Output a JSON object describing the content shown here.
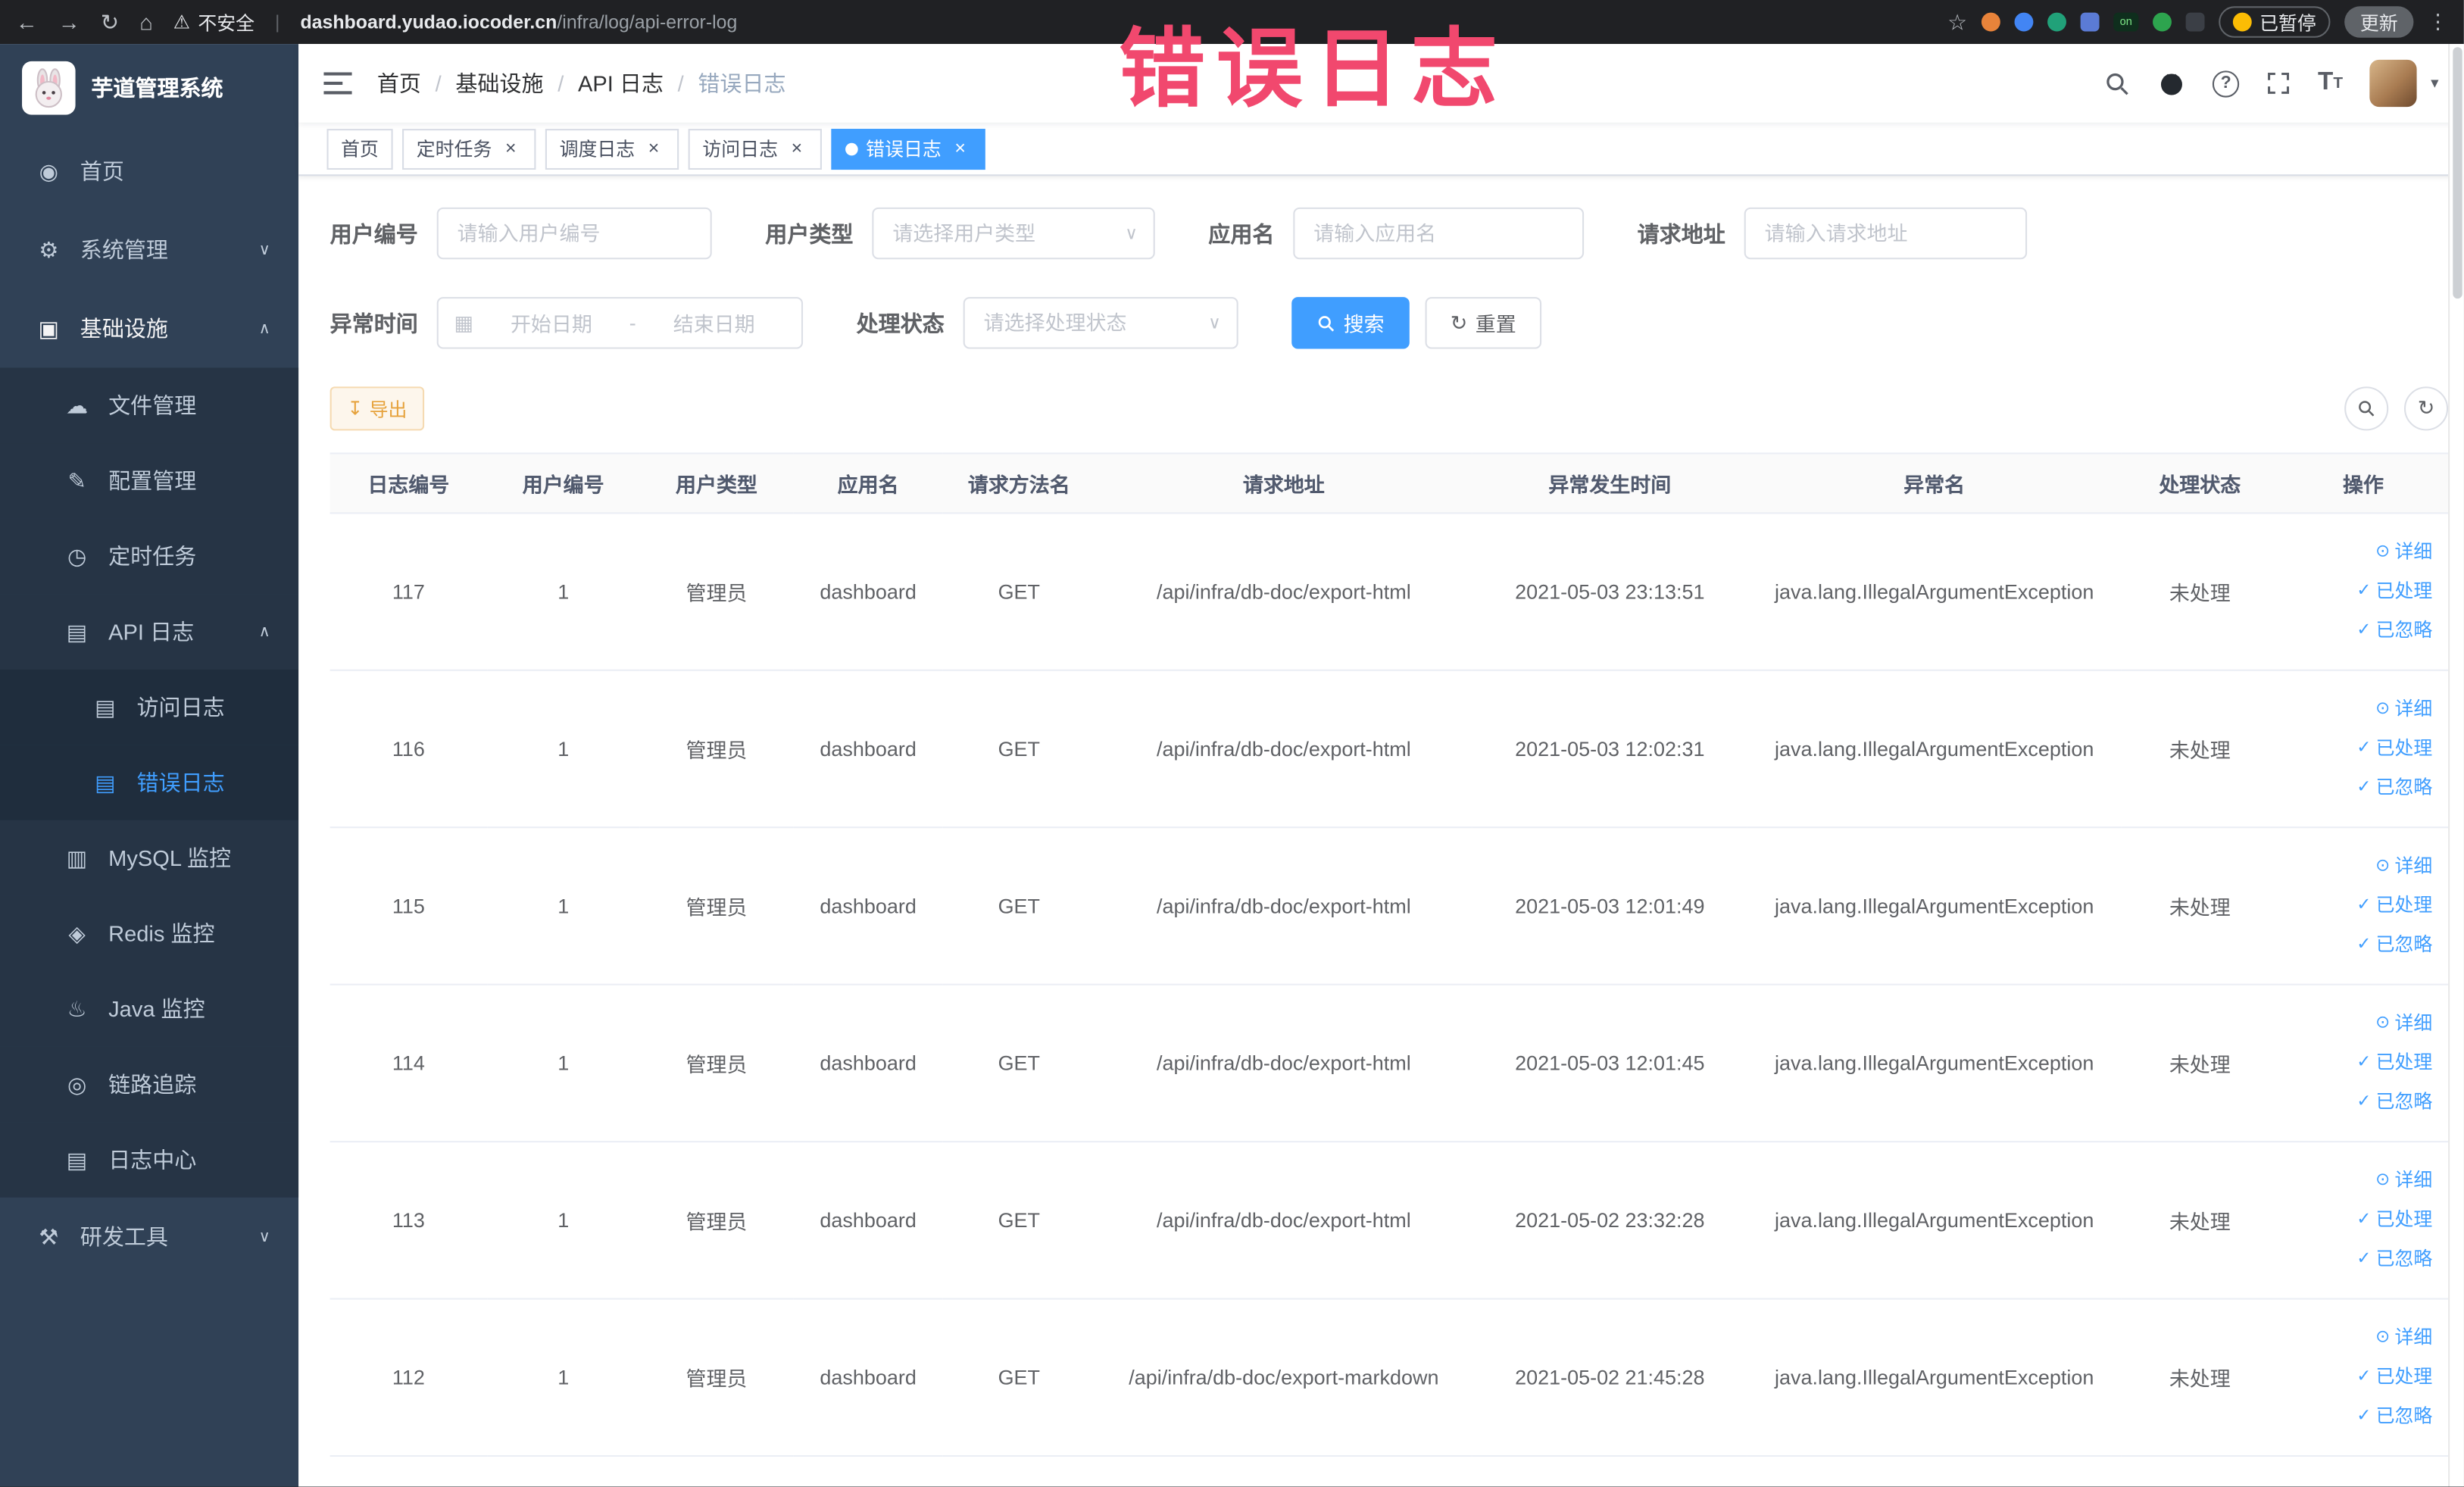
{
  "overlay": {
    "title": "错误日志"
  },
  "colors": {
    "accent": "#409eff",
    "sidebar_bg": "#304156",
    "active_tag_bg": "#409eff",
    "export_btn_text": "#e6a23c",
    "annotation_pink": "#f1486e"
  },
  "browser": {
    "security_label": "不安全",
    "url_domain": "dashboard.yudao.iocoder.cn",
    "url_path": "/infra/log/api-error-log",
    "ext_on_label": "on",
    "paused_label": "已暂停",
    "update_label": "更新"
  },
  "icons": {
    "back": "←",
    "forward": "→",
    "reload": "↻",
    "home": "⌂",
    "warning": "⚠",
    "divider": "|",
    "star": "☆",
    "more": "⋮",
    "help": "?",
    "caret_down": "∨",
    "caret_up": "∧",
    "caret_small": "▾",
    "menu_home": "◉",
    "menu_system": "⚙",
    "menu_infra": "▣",
    "menu_file": "☁",
    "menu_config": "✎",
    "menu_job": "◷",
    "menu_api_log": "▤",
    "menu_access_log": "▤",
    "menu_error_log": "▤",
    "menu_mysql": "▥",
    "menu_redis": "◈",
    "menu_java": "♨",
    "menu_trace": "◎",
    "menu_log_center": "▤",
    "menu_devtools": "⚒",
    "calendar": "▦",
    "refresh": "↻",
    "close": "×",
    "detail": "⊙",
    "check": "✓",
    "text_size_big": "T",
    "text_size_small": "T"
  },
  "sidebar": {
    "logo_title": "芋道管理系统",
    "items": [
      {
        "label": "首页"
      },
      {
        "label": "系统管理"
      },
      {
        "label": "基础设施"
      },
      {
        "label": "文件管理"
      },
      {
        "label": "配置管理"
      },
      {
        "label": "定时任务"
      },
      {
        "label": "API 日志"
      },
      {
        "label": "访问日志"
      },
      {
        "label": "错误日志"
      },
      {
        "label": "MySQL 监控"
      },
      {
        "label": "Redis 监控"
      },
      {
        "label": "Java 监控"
      },
      {
        "label": "链路追踪"
      },
      {
        "label": "日志中心"
      },
      {
        "label": "研发工具"
      }
    ]
  },
  "header": {
    "breadcrumb": [
      "首页",
      "基础设施",
      "API 日志",
      "错误日志"
    ],
    "separator": "/"
  },
  "tabs": [
    {
      "label": "首页"
    },
    {
      "label": "定时任务"
    },
    {
      "label": "调度日志"
    },
    {
      "label": "访问日志"
    },
    {
      "label": "错误日志"
    }
  ],
  "filters": {
    "user_id_label": "用户编号",
    "user_id_placeholder": "请输入用户编号",
    "user_type_label": "用户类型",
    "user_type_placeholder": "请选择用户类型",
    "app_name_label": "应用名",
    "app_name_placeholder": "请输入应用名",
    "request_url_label": "请求地址",
    "request_url_placeholder": "请输入请求地址",
    "exception_time_label": "异常时间",
    "start_placeholder": "开始日期",
    "range_separator": "-",
    "end_placeholder": "结束日期",
    "process_status_label": "处理状态",
    "process_status_placeholder": "请选择处理状态",
    "search_label": "搜索",
    "reset_label": "重置"
  },
  "toolbar": {
    "export_label": "导出"
  },
  "table": {
    "columns": [
      "日志编号",
      "用户编号",
      "用户类型",
      "应用名",
      "请求方法名",
      "请求地址",
      "异常发生时间",
      "异常名",
      "处理状态",
      "操作"
    ],
    "action_labels": [
      "详细",
      "已处理",
      "已忽略"
    ],
    "rows": [
      {
        "id": "117",
        "user_id": "1",
        "user_type": "管理员",
        "app": "dashboard",
        "method": "GET",
        "url": "/api/infra/db-doc/export-html",
        "time": "2021-05-03 23:13:51",
        "exception": "java.lang.IllegalArgumentException",
        "status": "未处理"
      },
      {
        "id": "116",
        "user_id": "1",
        "user_type": "管理员",
        "app": "dashboard",
        "method": "GET",
        "url": "/api/infra/db-doc/export-html",
        "time": "2021-05-03 12:02:31",
        "exception": "java.lang.IllegalArgumentException",
        "status": "未处理"
      },
      {
        "id": "115",
        "user_id": "1",
        "user_type": "管理员",
        "app": "dashboard",
        "method": "GET",
        "url": "/api/infra/db-doc/export-html",
        "time": "2021-05-03 12:01:49",
        "exception": "java.lang.IllegalArgumentException",
        "status": "未处理"
      },
      {
        "id": "114",
        "user_id": "1",
        "user_type": "管理员",
        "app": "dashboard",
        "method": "GET",
        "url": "/api/infra/db-doc/export-html",
        "time": "2021-05-03 12:01:45",
        "exception": "java.lang.IllegalArgumentException",
        "status": "未处理"
      },
      {
        "id": "113",
        "user_id": "1",
        "user_type": "管理员",
        "app": "dashboard",
        "method": "GET",
        "url": "/api/infra/db-doc/export-html",
        "time": "2021-05-02 23:32:28",
        "exception": "java.lang.IllegalArgumentException",
        "status": "未处理"
      },
      {
        "id": "112",
        "user_id": "1",
        "user_type": "管理员",
        "app": "dashboard",
        "method": "GET",
        "url": "/api/infra/db-doc/export-markdown",
        "time": "2021-05-02 21:45:28",
        "exception": "java.lang.IllegalArgumentException",
        "status": "未处理"
      }
    ]
  }
}
